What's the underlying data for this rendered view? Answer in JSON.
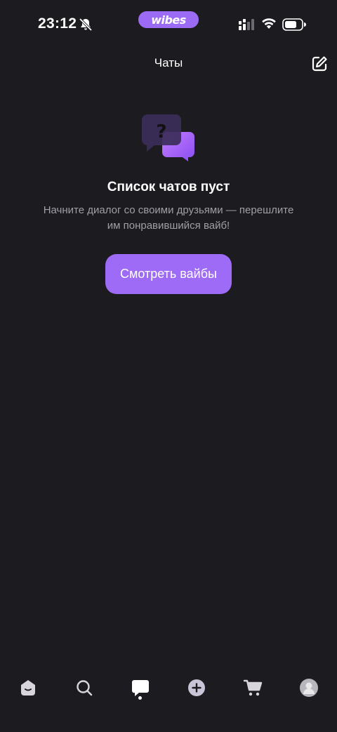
{
  "status_bar": {
    "time": "23:12",
    "brand": "wibes",
    "icons": [
      "bell-off-icon",
      "signal-icon",
      "wifi-icon",
      "battery-icon"
    ]
  },
  "header": {
    "title": "Чаты",
    "compose_icon": "compose-icon"
  },
  "empty_state": {
    "illustration": "chat-question-icon",
    "title": "Список чатов пуст",
    "description": "Начните диалог со своими друзьями — перешлите им понравившийся вайб!",
    "button_label": "Смотреть вайбы"
  },
  "bottom_nav": {
    "items": [
      "home-icon",
      "search-icon",
      "chats-icon",
      "add-icon",
      "cart-icon",
      "profile-icon"
    ],
    "active": "chats-icon"
  },
  "colors": {
    "background": "#1c1b1f",
    "accent": "#9d6bf5",
    "muted_text": "#a09fa6"
  }
}
